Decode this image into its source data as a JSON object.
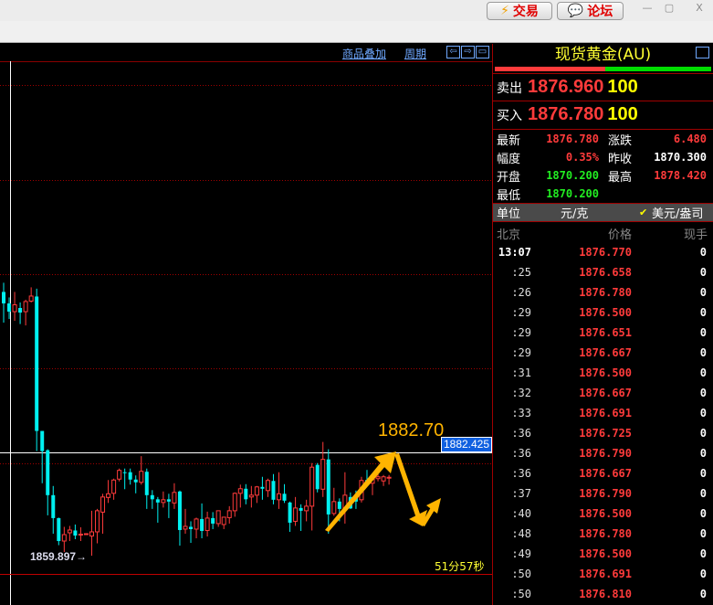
{
  "window": {
    "trade_btn": "交易",
    "forum_btn": "论坛",
    "min": "—",
    "max": "▢",
    "close": "X"
  },
  "chart": {
    "toolbar": {
      "overlay": "商品叠加",
      "period": "周期"
    },
    "crosshair_price": "1882.425",
    "low_label": "1859.897→",
    "target_label": "1882.70",
    "countdown": "51分57秒",
    "colors": {
      "up": "#ff3b3b",
      "down": "#00f0f0",
      "target": "#ffb400"
    }
  },
  "chart_data": {
    "type": "candlestick",
    "crosshair": 1882.425,
    "low": 1859.897,
    "target": 1882.7,
    "candles": [
      [
        1917.4,
        1914.9,
        1919.4,
        1910.7
      ],
      [
        1914.9,
        1913.1,
        1916.2,
        1911.5
      ],
      [
        1913.1,
        1914.6,
        1917.4,
        1911.1
      ],
      [
        1913.9,
        1912.9,
        1915.1,
        1910.4
      ],
      [
        1913.1,
        1915.3,
        1915.7,
        1910.1
      ],
      [
        1915.4,
        1916.5,
        1918.4,
        1915.1
      ],
      [
        1916.4,
        1887.1,
        1918.1,
        1882.7
      ],
      [
        1887.1,
        1882.7,
        1887.1,
        1875.7
      ],
      [
        1882.9,
        1873.1,
        1883.1,
        1868.7
      ],
      [
        1873.1,
        1868.1,
        1875.1,
        1864.7
      ],
      [
        1868.1,
        1863.1,
        1868.2,
        1862.2
      ],
      [
        1863.1,
        1864.5,
        1866.2,
        1860.7
      ],
      [
        1864.9,
        1865.5,
        1866.4,
        1863.1
      ],
      [
        1865.4,
        1864.3,
        1866.7,
        1863.5
      ],
      [
        1864.5,
        1864.6,
        1866.1,
        1863.1
      ],
      [
        1864.6,
        1864.7,
        1864.8,
        1864.5
      ],
      [
        1864.2,
        1865.1,
        1869.7,
        1859.9
      ],
      [
        1865.1,
        1869.7,
        1870.1,
        1862.6
      ],
      [
        1869.4,
        1872.7,
        1873.4,
        1864.7
      ],
      [
        1872.6,
        1873.4,
        1876.4,
        1871.4
      ],
      [
        1873.5,
        1876.4,
        1876.7,
        1872.1
      ],
      [
        1876.6,
        1878.5,
        1878.9,
        1876.1
      ],
      [
        1878.1,
        1878.0,
        1878.9,
        1874.4
      ],
      [
        1878.1,
        1876.5,
        1878.9,
        1875.4
      ],
      [
        1876.5,
        1875.9,
        1877.4,
        1873.5
      ],
      [
        1875.9,
        1878.3,
        1881.6,
        1875.4
      ],
      [
        1878.2,
        1873.1,
        1878.9,
        1870.1
      ],
      [
        1873.1,
        1872.2,
        1874.2,
        1870.1
      ],
      [
        1872.2,
        1871.5,
        1872.7,
        1867.1
      ],
      [
        1871.5,
        1872.1,
        1873.9,
        1870.4
      ],
      [
        1872.2,
        1871.7,
        1873.4,
        1868.1
      ],
      [
        1871.4,
        1873.7,
        1875.7,
        1870.1
      ],
      [
        1873.9,
        1865.5,
        1874.1,
        1862.1
      ],
      [
        1865.7,
        1866.3,
        1870.1,
        1864.7
      ],
      [
        1866.2,
        1865.7,
        1867.4,
        1862.7
      ],
      [
        1865.7,
        1867.9,
        1868.2,
        1863.7
      ],
      [
        1867.9,
        1865.3,
        1871.3,
        1863.7
      ],
      [
        1865.4,
        1868.1,
        1869.5,
        1864.1
      ],
      [
        1868.1,
        1866.9,
        1869.4,
        1865.7
      ],
      [
        1866.9,
        1869.7,
        1869.7,
        1866.2
      ],
      [
        1866.7,
        1868.3,
        1868.3,
        1865.7
      ],
      [
        1868.2,
        1869.7,
        1870.7,
        1866.9
      ],
      [
        1869.7,
        1873.5,
        1873.7,
        1868.4
      ],
      [
        1873.5,
        1874.5,
        1875.4,
        1870.4
      ],
      [
        1874.5,
        1872.2,
        1875.5,
        1871.1
      ],
      [
        1872.7,
        1873.1,
        1875.1,
        1870.4
      ],
      [
        1873.1,
        1874.9,
        1875.1,
        1871.4
      ],
      [
        1874.9,
        1874.5,
        1877.1,
        1872.1
      ],
      [
        1874.1,
        1876.3,
        1876.7,
        1872.7
      ],
      [
        1876.2,
        1872.1,
        1877.7,
        1871.1
      ],
      [
        1872.1,
        1873.4,
        1878.1,
        1870.1
      ],
      [
        1873.4,
        1871.9,
        1875.5,
        1871.4
      ],
      [
        1871.5,
        1867.1,
        1871.7,
        1865.1
      ],
      [
        1867.4,
        1870.3,
        1872.7,
        1866.4
      ],
      [
        1870.3,
        1869.7,
        1871.1,
        1865.3
      ],
      [
        1869.7,
        1870.7,
        1872.1,
        1867.4
      ],
      [
        1870.7,
        1879.2,
        1880.1,
        1865.4
      ],
      [
        1879.7,
        1874.4,
        1880.1,
        1873.7
      ],
      [
        1874.4,
        1880.9,
        1884.7,
        1872.7
      ],
      [
        1880.9,
        1868.9,
        1883.1,
        1864.7
      ],
      [
        1869.1,
        1871.7,
        1874.7,
        1868.6
      ],
      [
        1871.7,
        1870.1,
        1872.4,
        1867.4
      ],
      [
        1870.1,
        1873.1,
        1878.1,
        1866.9
      ],
      [
        1872.7,
        1870.2,
        1873.7,
        1870.1
      ],
      [
        1873.1,
        1871.7,
        1874.1,
        1870.1
      ],
      [
        1872.1,
        1876.3,
        1877.1,
        1871.5
      ],
      [
        1876.4,
        1875.9,
        1878.6,
        1875.4
      ],
      [
        1875.7,
        1876.9,
        1877.4,
        1873.1
      ],
      [
        1876.7,
        1877.1,
        1877.7,
        1876.1
      ],
      [
        1876.2,
        1877.1,
        1877.5,
        1875.1
      ],
      [
        1876.9,
        1877.0,
        1877.5,
        1875.4
      ]
    ]
  },
  "panel": {
    "title": "现货黄金(AU)",
    "bar_colors": {
      "red": "#ff3b3b",
      "green": "#00dd00"
    },
    "bar_red_fraction": 0.51,
    "sell": {
      "label": "卖出",
      "price": "1876.960",
      "vol": "100"
    },
    "buy": {
      "label": "买入",
      "price": "1876.780",
      "vol": "100"
    },
    "stats": {
      "latest": {
        "label": "最新",
        "value": "1876.780"
      },
      "change": {
        "label": "涨跌",
        "value": "6.480"
      },
      "pct": {
        "label": "幅度",
        "value": "0.35%"
      },
      "prev": {
        "label": "昨收",
        "value": "1870.300"
      },
      "open": {
        "label": "开盘",
        "value": "1870.200"
      },
      "high": {
        "label": "最高",
        "value": "1878.420"
      },
      "low": {
        "label": "最低",
        "value": "1870.200"
      }
    },
    "unit": {
      "label": "单位",
      "opt1": "元/克",
      "check": "✔",
      "opt2": "美元/盎司"
    },
    "ticks_header": {
      "time": "北京",
      "price": "价格",
      "vol": "现手"
    },
    "ticks": [
      {
        "t": "13:07",
        "p": "1876.770",
        "v": "0"
      },
      {
        "t": ":25",
        "p": "1876.658",
        "v": "0"
      },
      {
        "t": ":26",
        "p": "1876.780",
        "v": "0"
      },
      {
        "t": ":29",
        "p": "1876.500",
        "v": "0"
      },
      {
        "t": ":29",
        "p": "1876.651",
        "v": "0"
      },
      {
        "t": ":29",
        "p": "1876.667",
        "v": "0"
      },
      {
        "t": ":31",
        "p": "1876.500",
        "v": "0"
      },
      {
        "t": ":32",
        "p": "1876.667",
        "v": "0"
      },
      {
        "t": ":33",
        "p": "1876.691",
        "v": "0"
      },
      {
        "t": ":36",
        "p": "1876.725",
        "v": "0"
      },
      {
        "t": ":36",
        "p": "1876.790",
        "v": "0"
      },
      {
        "t": ":36",
        "p": "1876.667",
        "v": "0"
      },
      {
        "t": ":37",
        "p": "1876.790",
        "v": "0"
      },
      {
        "t": ":40",
        "p": "1876.500",
        "v": "0"
      },
      {
        "t": ":48",
        "p": "1876.780",
        "v": "0"
      },
      {
        "t": ":49",
        "p": "1876.500",
        "v": "0"
      },
      {
        "t": ":50",
        "p": "1876.691",
        "v": "0"
      },
      {
        "t": ":50",
        "p": "1876.810",
        "v": "0"
      }
    ]
  }
}
